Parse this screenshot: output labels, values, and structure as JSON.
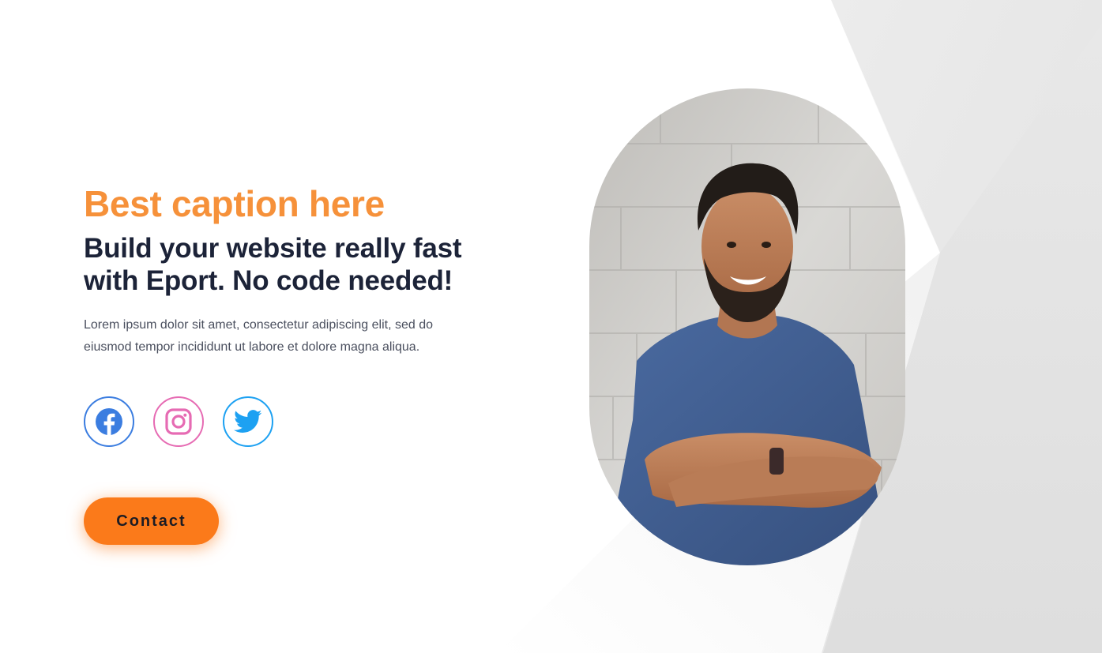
{
  "hero": {
    "caption": "Best caption here",
    "headline_line1": "Build your website really fast",
    "headline_line2": "with Eport. No code needed!",
    "description_line1": "Lorem ipsum dolor sit amet, consectetur adipiscing elit, sed do",
    "description_line2": "eiusmod tempor incididunt ut labore et dolore magna aliqua."
  },
  "socials": [
    {
      "icon": "facebook-icon",
      "color": "#3b7de0"
    },
    {
      "icon": "instagram-icon",
      "color": "#e66bb3"
    },
    {
      "icon": "twitter-icon",
      "color": "#1da1f2"
    }
  ],
  "contact_button": {
    "label": "Contact",
    "color": "#fb7a1a"
  },
  "colors": {
    "caption": "#f6913a",
    "headline": "#1c2338",
    "text": "#4a4f5e",
    "background_shape": "#e4e4e4"
  },
  "photo": {
    "alt": "Smiling man with crossed arms in blue t-shirt"
  }
}
